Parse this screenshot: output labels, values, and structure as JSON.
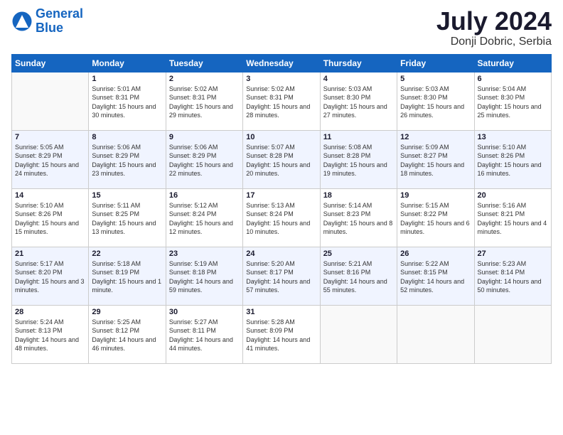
{
  "logo": {
    "text_general": "General",
    "text_blue": "Blue"
  },
  "header": {
    "title": "July 2024",
    "subtitle": "Donji Dobric, Serbia"
  },
  "days": [
    "Sunday",
    "Monday",
    "Tuesday",
    "Wednesday",
    "Thursday",
    "Friday",
    "Saturday"
  ],
  "weeks": [
    [
      {
        "date": "",
        "sunrise": "",
        "sunset": "",
        "daylight": ""
      },
      {
        "date": "1",
        "sunrise": "Sunrise: 5:01 AM",
        "sunset": "Sunset: 8:31 PM",
        "daylight": "Daylight: 15 hours and 30 minutes."
      },
      {
        "date": "2",
        "sunrise": "Sunrise: 5:02 AM",
        "sunset": "Sunset: 8:31 PM",
        "daylight": "Daylight: 15 hours and 29 minutes."
      },
      {
        "date": "3",
        "sunrise": "Sunrise: 5:02 AM",
        "sunset": "Sunset: 8:31 PM",
        "daylight": "Daylight: 15 hours and 28 minutes."
      },
      {
        "date": "4",
        "sunrise": "Sunrise: 5:03 AM",
        "sunset": "Sunset: 8:30 PM",
        "daylight": "Daylight: 15 hours and 27 minutes."
      },
      {
        "date": "5",
        "sunrise": "Sunrise: 5:03 AM",
        "sunset": "Sunset: 8:30 PM",
        "daylight": "Daylight: 15 hours and 26 minutes."
      },
      {
        "date": "6",
        "sunrise": "Sunrise: 5:04 AM",
        "sunset": "Sunset: 8:30 PM",
        "daylight": "Daylight: 15 hours and 25 minutes."
      }
    ],
    [
      {
        "date": "7",
        "sunrise": "Sunrise: 5:05 AM",
        "sunset": "Sunset: 8:29 PM",
        "daylight": "Daylight: 15 hours and 24 minutes."
      },
      {
        "date": "8",
        "sunrise": "Sunrise: 5:06 AM",
        "sunset": "Sunset: 8:29 PM",
        "daylight": "Daylight: 15 hours and 23 minutes."
      },
      {
        "date": "9",
        "sunrise": "Sunrise: 5:06 AM",
        "sunset": "Sunset: 8:29 PM",
        "daylight": "Daylight: 15 hours and 22 minutes."
      },
      {
        "date": "10",
        "sunrise": "Sunrise: 5:07 AM",
        "sunset": "Sunset: 8:28 PM",
        "daylight": "Daylight: 15 hours and 20 minutes."
      },
      {
        "date": "11",
        "sunrise": "Sunrise: 5:08 AM",
        "sunset": "Sunset: 8:28 PM",
        "daylight": "Daylight: 15 hours and 19 minutes."
      },
      {
        "date": "12",
        "sunrise": "Sunrise: 5:09 AM",
        "sunset": "Sunset: 8:27 PM",
        "daylight": "Daylight: 15 hours and 18 minutes."
      },
      {
        "date": "13",
        "sunrise": "Sunrise: 5:10 AM",
        "sunset": "Sunset: 8:26 PM",
        "daylight": "Daylight: 15 hours and 16 minutes."
      }
    ],
    [
      {
        "date": "14",
        "sunrise": "Sunrise: 5:10 AM",
        "sunset": "Sunset: 8:26 PM",
        "daylight": "Daylight: 15 hours and 15 minutes."
      },
      {
        "date": "15",
        "sunrise": "Sunrise: 5:11 AM",
        "sunset": "Sunset: 8:25 PM",
        "daylight": "Daylight: 15 hours and 13 minutes."
      },
      {
        "date": "16",
        "sunrise": "Sunrise: 5:12 AM",
        "sunset": "Sunset: 8:24 PM",
        "daylight": "Daylight: 15 hours and 12 minutes."
      },
      {
        "date": "17",
        "sunrise": "Sunrise: 5:13 AM",
        "sunset": "Sunset: 8:24 PM",
        "daylight": "Daylight: 15 hours and 10 minutes."
      },
      {
        "date": "18",
        "sunrise": "Sunrise: 5:14 AM",
        "sunset": "Sunset: 8:23 PM",
        "daylight": "Daylight: 15 hours and 8 minutes."
      },
      {
        "date": "19",
        "sunrise": "Sunrise: 5:15 AM",
        "sunset": "Sunset: 8:22 PM",
        "daylight": "Daylight: 15 hours and 6 minutes."
      },
      {
        "date": "20",
        "sunrise": "Sunrise: 5:16 AM",
        "sunset": "Sunset: 8:21 PM",
        "daylight": "Daylight: 15 hours and 4 minutes."
      }
    ],
    [
      {
        "date": "21",
        "sunrise": "Sunrise: 5:17 AM",
        "sunset": "Sunset: 8:20 PM",
        "daylight": "Daylight: 15 hours and 3 minutes."
      },
      {
        "date": "22",
        "sunrise": "Sunrise: 5:18 AM",
        "sunset": "Sunset: 8:19 PM",
        "daylight": "Daylight: 15 hours and 1 minute."
      },
      {
        "date": "23",
        "sunrise": "Sunrise: 5:19 AM",
        "sunset": "Sunset: 8:18 PM",
        "daylight": "Daylight: 14 hours and 59 minutes."
      },
      {
        "date": "24",
        "sunrise": "Sunrise: 5:20 AM",
        "sunset": "Sunset: 8:17 PM",
        "daylight": "Daylight: 14 hours and 57 minutes."
      },
      {
        "date": "25",
        "sunrise": "Sunrise: 5:21 AM",
        "sunset": "Sunset: 8:16 PM",
        "daylight": "Daylight: 14 hours and 55 minutes."
      },
      {
        "date": "26",
        "sunrise": "Sunrise: 5:22 AM",
        "sunset": "Sunset: 8:15 PM",
        "daylight": "Daylight: 14 hours and 52 minutes."
      },
      {
        "date": "27",
        "sunrise": "Sunrise: 5:23 AM",
        "sunset": "Sunset: 8:14 PM",
        "daylight": "Daylight: 14 hours and 50 minutes."
      }
    ],
    [
      {
        "date": "28",
        "sunrise": "Sunrise: 5:24 AM",
        "sunset": "Sunset: 8:13 PM",
        "daylight": "Daylight: 14 hours and 48 minutes."
      },
      {
        "date": "29",
        "sunrise": "Sunrise: 5:25 AM",
        "sunset": "Sunset: 8:12 PM",
        "daylight": "Daylight: 14 hours and 46 minutes."
      },
      {
        "date": "30",
        "sunrise": "Sunrise: 5:27 AM",
        "sunset": "Sunset: 8:11 PM",
        "daylight": "Daylight: 14 hours and 44 minutes."
      },
      {
        "date": "31",
        "sunrise": "Sunrise: 5:28 AM",
        "sunset": "Sunset: 8:09 PM",
        "daylight": "Daylight: 14 hours and 41 minutes."
      },
      {
        "date": "",
        "sunrise": "",
        "sunset": "",
        "daylight": ""
      },
      {
        "date": "",
        "sunrise": "",
        "sunset": "",
        "daylight": ""
      },
      {
        "date": "",
        "sunrise": "",
        "sunset": "",
        "daylight": ""
      }
    ]
  ]
}
